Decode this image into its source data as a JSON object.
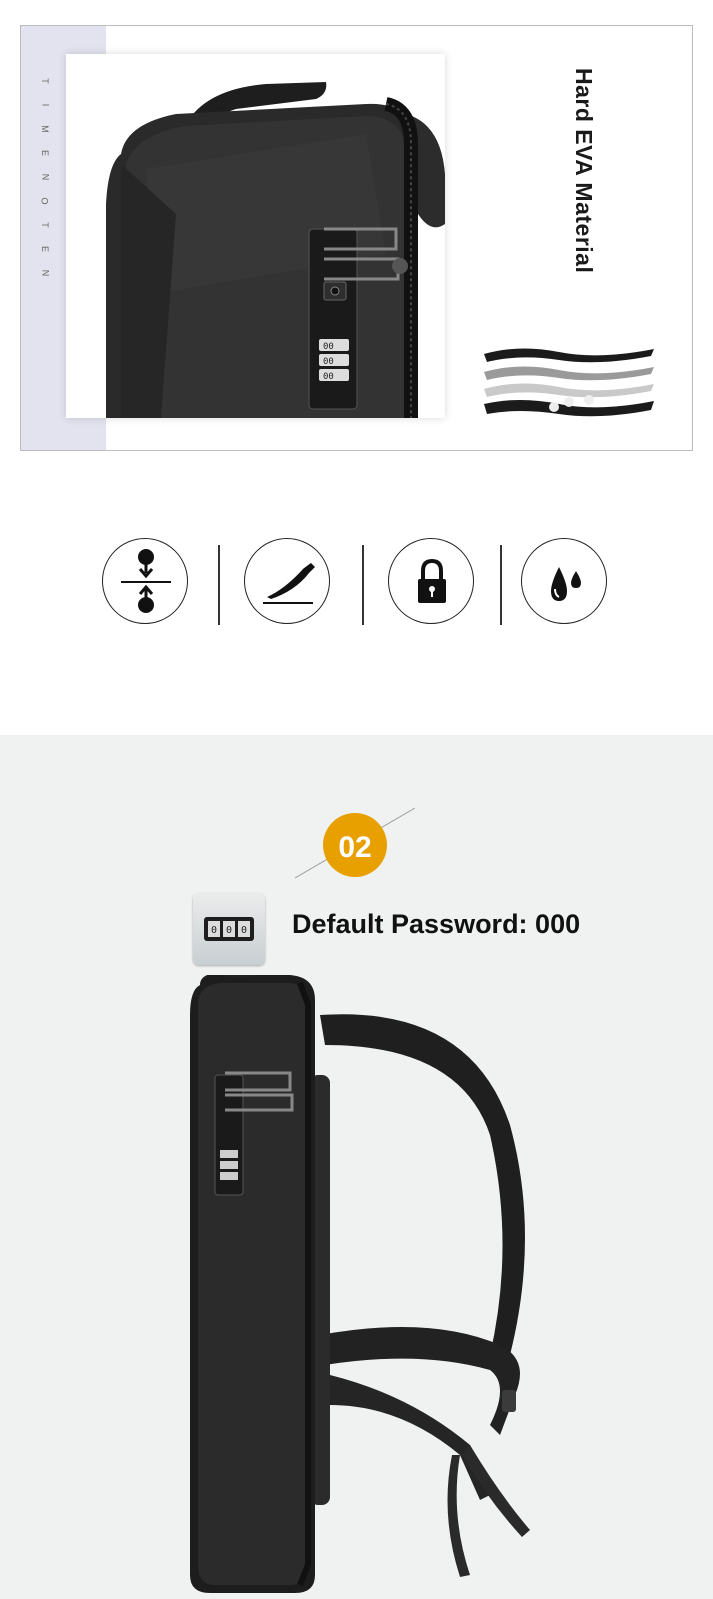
{
  "top_panel": {
    "brand_vertical": "TIMENOTEN",
    "material_title": "Hard EVA Material"
  },
  "features": {
    "icons": [
      "compression-resistant-icon",
      "anti-cut-icon",
      "lock-icon",
      "waterproof-icon"
    ]
  },
  "lock_section": {
    "step_number": "02",
    "password_label": "Default Password: 000",
    "lock_dials": "000"
  },
  "colors": {
    "accent": "#e8a000",
    "strip": "#e3e3ef",
    "bottom_bg": "#f0f2f2",
    "bag": "#262626"
  }
}
